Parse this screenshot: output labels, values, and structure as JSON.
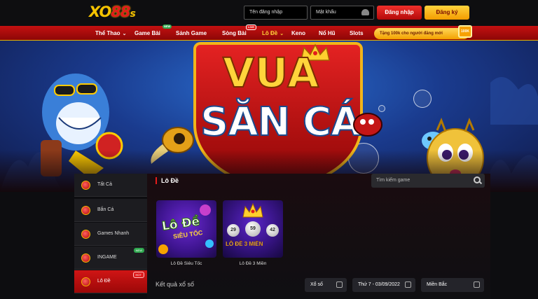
{
  "header": {
    "logo": {
      "main": "XO",
      "digits": "88",
      "suffix": "s"
    },
    "username_placeholder": "Tên đăng nhập",
    "password_placeholder": "Mật khẩu",
    "login_label": "Đăng nhập",
    "register_label": "Đăng ký"
  },
  "nav": {
    "items": [
      {
        "label": "Thể Thao",
        "chevron": true
      },
      {
        "label": "Game Bài",
        "badge": "NEW"
      },
      {
        "label": "Sảnh Game"
      },
      {
        "label": "Sòng Bài",
        "badge": "LIVE"
      },
      {
        "label": "Lô Đề",
        "chevron": true,
        "active": true
      },
      {
        "label": "Keno"
      },
      {
        "label": "Nổ Hũ"
      },
      {
        "label": "Slots"
      }
    ],
    "promo": "Tặng 100k cho người đăng mới",
    "promo_gift": "100K"
  },
  "banner": {
    "line1": "VUA",
    "line2": "SĂN CÁ"
  },
  "sidebar": {
    "items": [
      {
        "label": "Tất Cả"
      },
      {
        "label": "Bắn Cá"
      },
      {
        "label": "Games Nhanh"
      },
      {
        "label": "INGAME",
        "badge": "NEW"
      },
      {
        "label": "Lô Đề",
        "badge": "HOT",
        "active": true
      }
    ]
  },
  "main": {
    "section_title": "Lô Đề",
    "search_placeholder": "Tìm kiếm game",
    "games": [
      {
        "caption": "Lô Đề Siêu Tốc",
        "art_line1": "Lô Đề",
        "art_line2": "SIÊU TỐC"
      },
      {
        "caption": "Lô Đề 3 Miền",
        "art_line": "LÔ ĐỀ 3 MIỀN",
        "balls": [
          "29",
          "59",
          "42"
        ]
      }
    ],
    "results_label": "Kết quả xổ số",
    "filters": {
      "type": "Xổ số",
      "date": "Thứ 7 - 03/09/2022",
      "region": "Miền Bắc"
    }
  },
  "colors": {
    "brand_red": "#c41010",
    "brand_gold": "#ffd43b",
    "background": "#0d0d10"
  }
}
